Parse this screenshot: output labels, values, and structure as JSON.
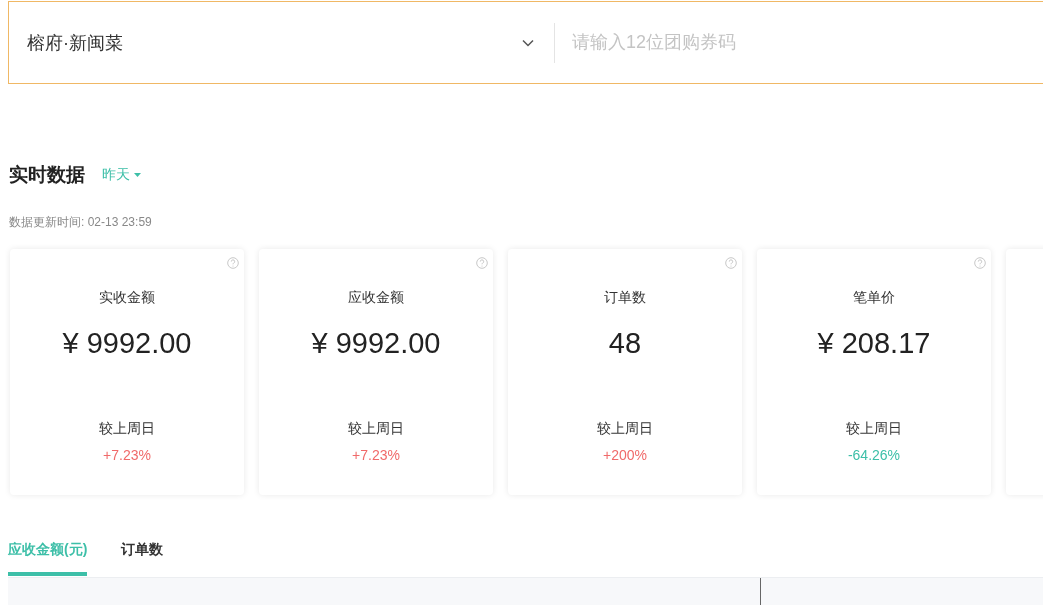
{
  "store_select": {
    "value": "榕府·新闽菜"
  },
  "coupon_input": {
    "placeholder": "请输入12位团购券码"
  },
  "realtime": {
    "title": "实时数据",
    "period": "昨天",
    "updated": "数据更新时间: 02-13 23:59"
  },
  "cards": [
    {
      "label": "实收金额",
      "value": "¥ 9992.00",
      "compare_label": "较上周日",
      "change": "+7.23%",
      "color": "#f06a6a"
    },
    {
      "label": "应收金额",
      "value": "¥ 9992.00",
      "compare_label": "较上周日",
      "change": "+7.23%",
      "color": "#f06a6a"
    },
    {
      "label": "订单数",
      "value": "48",
      "compare_label": "较上周日",
      "change": "+200%",
      "color": "#f06a6a"
    },
    {
      "label": "笔单价",
      "value": "¥ 208.17",
      "compare_label": "较上周日",
      "change": "-64.26%",
      "color": "#3dbfa8"
    }
  ],
  "chart_tabs": [
    {
      "label": "应收金额(元)",
      "selected": true
    },
    {
      "label": "订单数",
      "selected": false
    }
  ]
}
